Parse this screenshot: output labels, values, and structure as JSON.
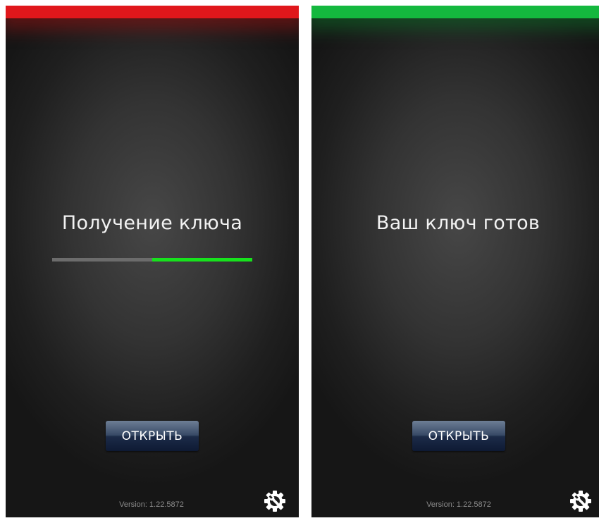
{
  "left_screen": {
    "status_color": "#e0171b",
    "title": "Получение ключа",
    "progress_fraction": 0.5,
    "progress_color": "#17e21d",
    "button_label": "ОТКРЫТЬ",
    "version": "Version: 1.22.5872",
    "settings_icon": "gear-wrench-icon"
  },
  "right_screen": {
    "status_color": "#14b83e",
    "title": "Ваш ключ готов",
    "button_label": "ОТКРЫТЬ",
    "version": "Version: 1.22.5872",
    "settings_icon": "gear-wrench-icon"
  }
}
